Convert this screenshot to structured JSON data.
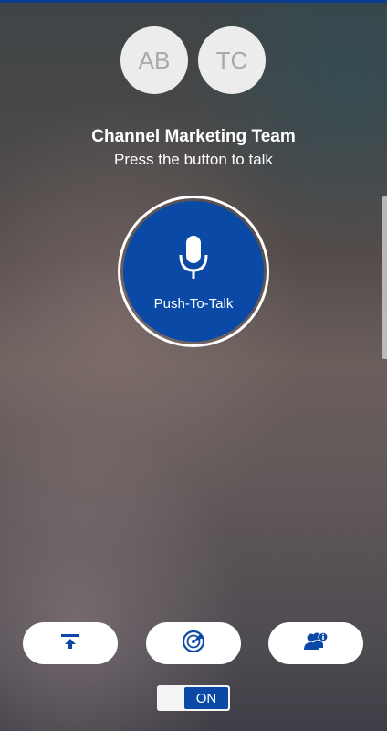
{
  "participants": [
    {
      "initials": "AB"
    },
    {
      "initials": "TC"
    }
  ],
  "channel": {
    "name": "Channel Marketing Team",
    "instruction": "Press the button to talk"
  },
  "ptt_button": {
    "label": "Push-To-Talk",
    "icon": "microphone-icon"
  },
  "actions": [
    {
      "icon": "upload-icon"
    },
    {
      "icon": "radar-icon"
    },
    {
      "icon": "contacts-info-icon"
    }
  ],
  "toggle": {
    "state_label": "ON"
  },
  "colors": {
    "accent": "#0a4aa6",
    "button_bg": "#ffffff",
    "avatar_bg": "#ececec"
  }
}
